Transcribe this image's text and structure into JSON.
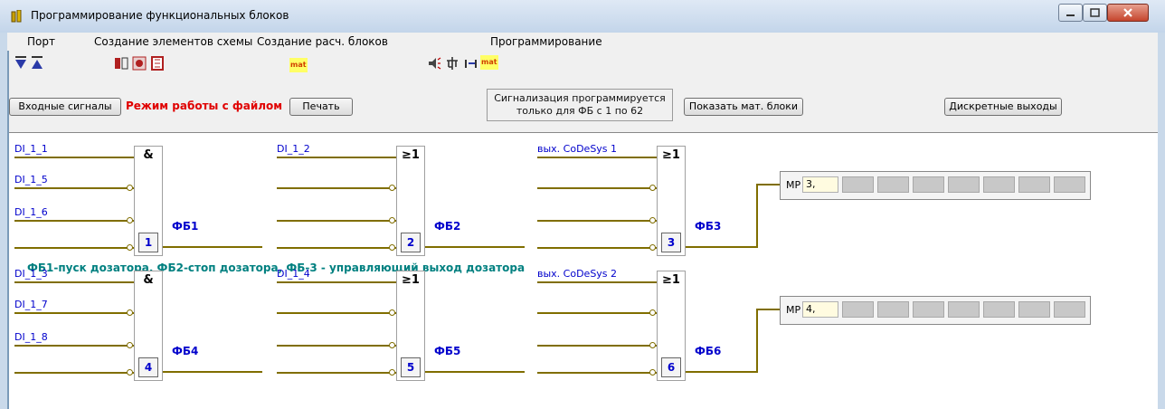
{
  "window": {
    "title": "Программирование функциональных блоков"
  },
  "menu": [
    "Порт",
    "Создание элементов схемы",
    "Создание расч. блоков",
    "Программирование"
  ],
  "toolbar": {
    "icons": [
      "arrow-down-icon",
      "arrow-up-icon",
      "block-icon-1",
      "block-icon-2",
      "block-icon-3",
      "mat-icon",
      "speaker-icon",
      "tree-icon",
      "bar-icon",
      "mat-icon-2"
    ],
    "mat_label": "mat"
  },
  "buttons": {
    "input_signals": "Входные сигналы",
    "print": "Печать",
    "show_mat_blocks": "Показать мат. блоки",
    "discrete_outputs": "Дискретные выходы"
  },
  "mode_label": "Режим работы с файлом",
  "signal_note": {
    "line1": "Сигнализация программируется",
    "line2": "только для ФБ с 1 по 62"
  },
  "comment": "ФБ1-пуск дозатора, ФБ2-стоп дозатора, ФБ-3 - управляющий выход дозатора",
  "rows": [
    {
      "blocks": [
        {
          "num": "1",
          "sym": "&",
          "label": "ФБ1",
          "inputs": [
            "DI_1_1",
            "DI_1_5",
            "DI_1_6",
            ""
          ]
        },
        {
          "num": "2",
          "sym": "≥1",
          "label": "ФБ2",
          "inputs": [
            "DI_1_2",
            "",
            "",
            ""
          ]
        },
        {
          "num": "3",
          "sym": "≥1",
          "label": "ФБ3",
          "inputs": [
            "вых. CoDeSys 1",
            "",
            "",
            ""
          ]
        }
      ],
      "mp": {
        "label": "МР",
        "value": "3,"
      }
    },
    {
      "blocks": [
        {
          "num": "4",
          "sym": "&",
          "label": "ФБ4",
          "inputs": [
            "DI_1_3",
            "DI_1_7",
            "DI_1_8",
            ""
          ]
        },
        {
          "num": "5",
          "sym": "≥1",
          "label": "ФБ5",
          "inputs": [
            "DI_1_4",
            "",
            "",
            ""
          ]
        },
        {
          "num": "6",
          "sym": "≥1",
          "label": "ФБ6",
          "inputs": [
            "вых. CoDeSys 2",
            "",
            "",
            ""
          ]
        }
      ],
      "mp": {
        "label": "МР",
        "value": "4,"
      }
    }
  ],
  "colors": {
    "wire": "#806e00",
    "signal": "#0000cc",
    "comment": "#008080",
    "mode": "#e00000"
  }
}
